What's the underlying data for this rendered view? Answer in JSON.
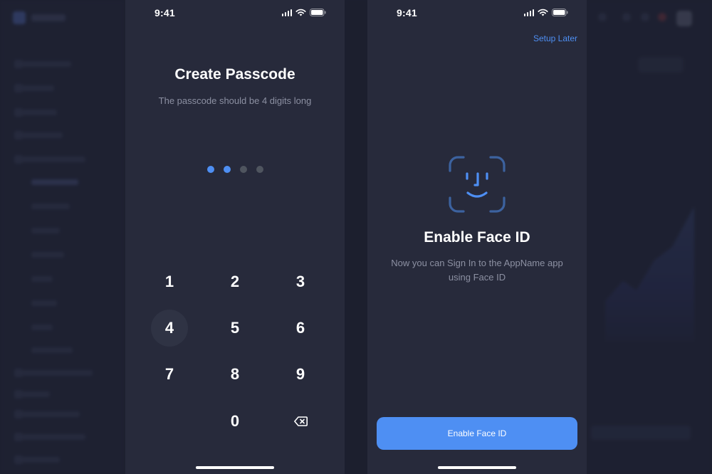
{
  "colors": {
    "accent": "#4e8ff3",
    "phone_background": "#272a3b",
    "page_background": "#1d2030",
    "muted_text": "#8c90a2",
    "dot_empty": "#4f555f"
  },
  "passcode_screen": {
    "status": {
      "time": "9:41"
    },
    "title": "Create Passcode",
    "subtitle": "The passcode should be 4 digits long",
    "digits_entered": 2,
    "digits_total": 4,
    "keypad": {
      "keys": [
        "1",
        "2",
        "3",
        "4",
        "5",
        "6",
        "7",
        "8",
        "9",
        "0"
      ],
      "pressed_key": "4",
      "delete_icon": "backspace-icon"
    }
  },
  "faceid_screen": {
    "status": {
      "time": "9:41"
    },
    "setup_later_label": "Setup Later",
    "icon": "face-id-icon",
    "title": "Enable Face ID",
    "description_line1": "Now you can Sign In to the AppName app",
    "description_line2": "using Face ID",
    "button_label": "Enable Face ID"
  }
}
